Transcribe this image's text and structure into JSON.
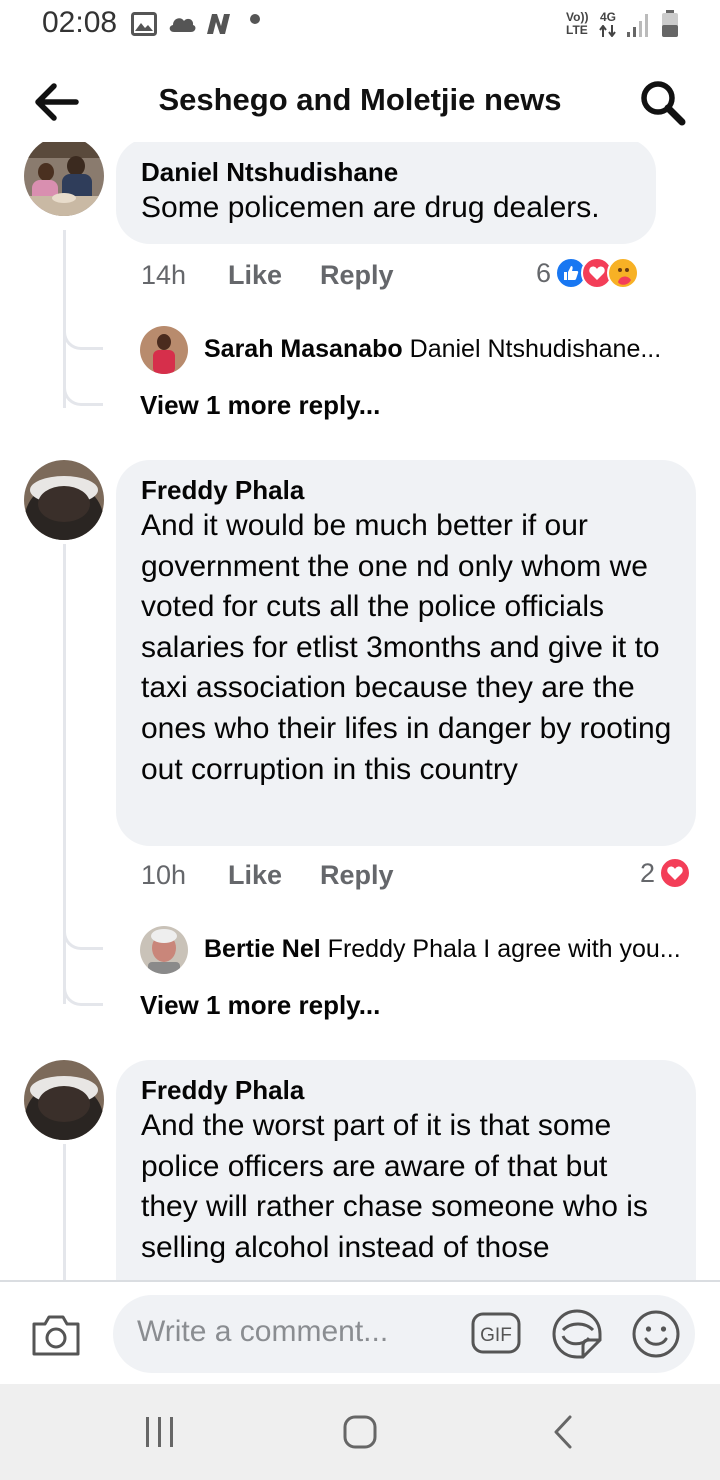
{
  "status_bar": {
    "time": "02:08",
    "network_volte": "Vo))",
    "network_lte": "LTE",
    "network_4g": "4G",
    "icons": [
      "gallery-icon",
      "cloud-icon",
      "news-app-icon",
      "wifi-signal-icon",
      "battery-icon"
    ]
  },
  "header": {
    "title": "Seshego and Moletjie news",
    "back_icon": "arrow-left-icon",
    "search_icon": "search-icon"
  },
  "comments": [
    {
      "author": "Daniel Ntshudishane",
      "text": "Some policemen are drug dealers.",
      "time": "14h",
      "like_label": "Like",
      "reply_label": "Reply",
      "reaction_count": "6",
      "reactions": [
        "like",
        "love",
        "care"
      ],
      "reply_preview": {
        "author": "Sarah Masanabo",
        "text": "Daniel Ntshudishane..."
      },
      "more_replies": "View 1 more reply..."
    },
    {
      "author": "Freddy Phala",
      "text": "And it would be much better if our government the one nd only whom we voted for cuts all the police officials salaries for etlist 3months and give it to taxi association because they are the ones who their lifes in danger by rooting out corruption in this country",
      "time": "10h",
      "like_label": "Like",
      "reply_label": "Reply",
      "reaction_count": "2",
      "reactions": [
        "love"
      ],
      "reply_preview": {
        "author": "Bertie Nel",
        "text": "Freddy Phala I agree with you..."
      },
      "more_replies": "View 1 more reply..."
    },
    {
      "author": "Freddy Phala",
      "text": "And the worst part of it is that some police officers are aware of that but they will rather chase someone who is selling alcohol instead of those"
    }
  ],
  "composer": {
    "placeholder": "Write a comment...",
    "gif_label": "GIF",
    "icons": [
      "camera-icon",
      "gif-icon",
      "sticker-icon",
      "emoji-icon"
    ]
  },
  "nav_bar": {
    "icons": [
      "recent-apps-icon",
      "home-icon",
      "back-icon"
    ]
  },
  "colors": {
    "bubble": "#f0f2f5",
    "meta_text": "#65676b",
    "like_blue": "#1877f2",
    "love_red": "#f33e58",
    "care_yellow": "#f7b125",
    "thread_line": "#e4e6eb"
  }
}
